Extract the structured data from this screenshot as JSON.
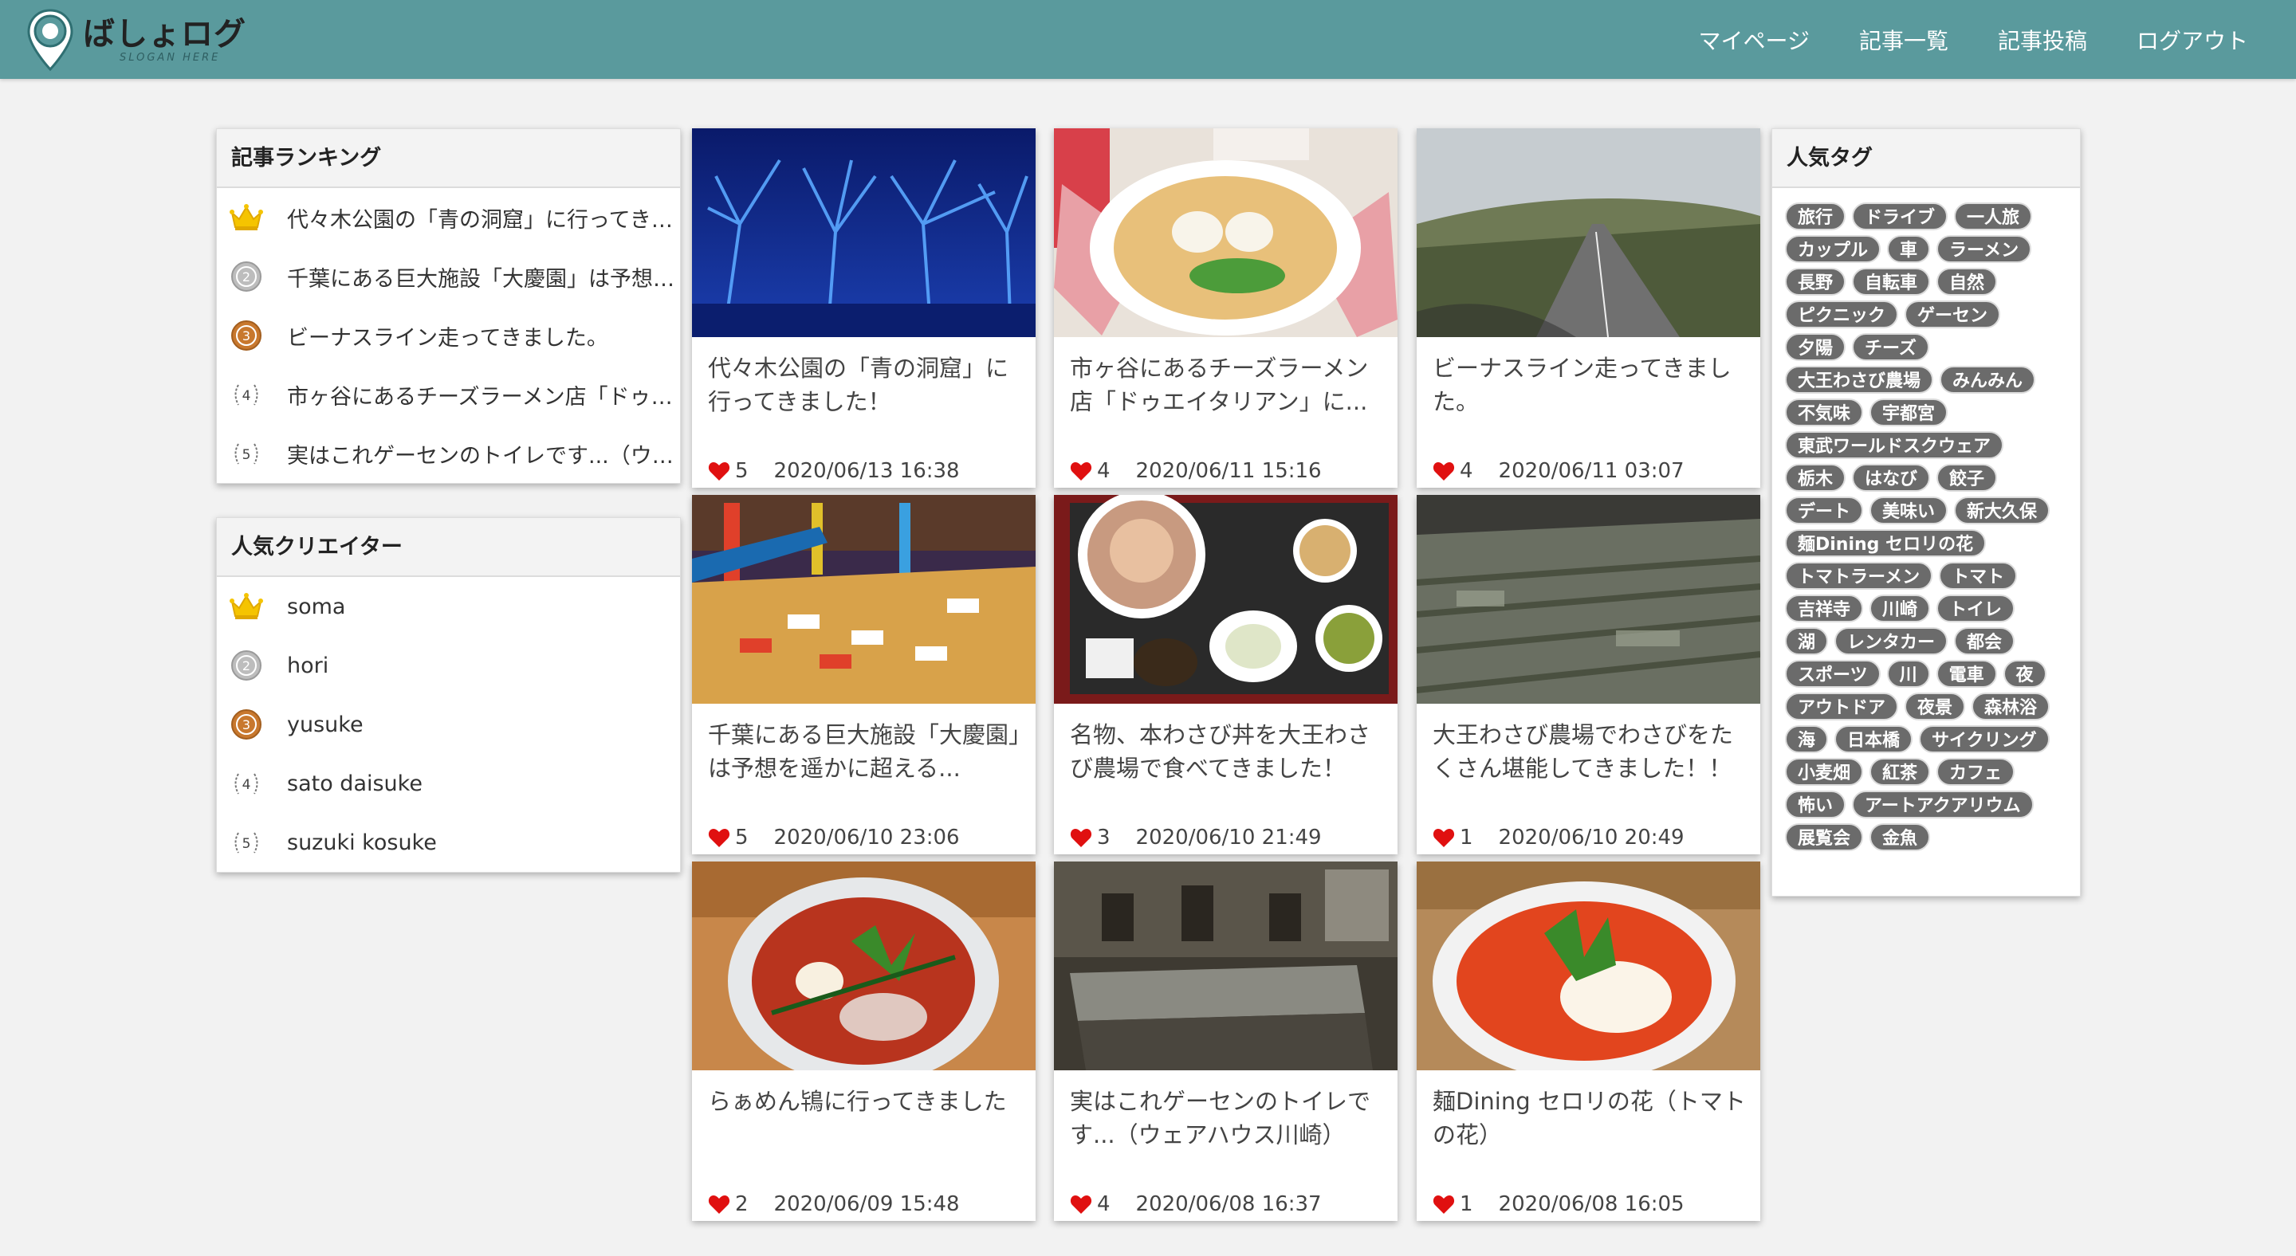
{
  "header": {
    "logo_text": "ばしょログ",
    "logo_sub": "SLOGAN HERE",
    "nav": [
      "マイページ",
      "記事一覧",
      "記事投稿",
      "ログアウト"
    ]
  },
  "ranking": {
    "title": "記事ランキング",
    "items": [
      "代々木公園の「青の洞窟」に行ってきました！",
      "千葉にある巨大施設「大慶園」は予想を遥かに超える...",
      "ビーナスライン走ってきました。",
      "市ヶ谷にあるチーズラーメン店「ドゥエイタリアン」に...",
      "実はこれゲーセンのトイレです...（ウェアハウス川崎）"
    ]
  },
  "creators": {
    "title": "人気クリエイター",
    "items": [
      "soma",
      "hori",
      "yusuke",
      "sato daisuke",
      "suzuki kosuke"
    ]
  },
  "articles": [
    {
      "title": "代々木公園の「青の洞窟」に行ってきました！",
      "likes": "5",
      "date": "2020/06/13 16:38"
    },
    {
      "title": "市ヶ谷にあるチーズラーメン店「ドゥエイタリアン」に...",
      "likes": "4",
      "date": "2020/06/11 15:16"
    },
    {
      "title": "ビーナスライン走ってきました。",
      "likes": "4",
      "date": "2020/06/11 03:07"
    },
    {
      "title": "千葉にある巨大施設「大慶園」は予想を遥かに超える...",
      "likes": "5",
      "date": "2020/06/10 23:06"
    },
    {
      "title": "名物、本わさび丼を大王わさび農場で食べてきました！",
      "likes": "3",
      "date": "2020/06/10 21:49"
    },
    {
      "title": "大王わさび農場でわさびをたくさん堪能してきました！！",
      "likes": "1",
      "date": "2020/06/10 20:49"
    },
    {
      "title": "らぁめん鴇に行ってきました",
      "likes": "2",
      "date": "2020/06/09 15:48"
    },
    {
      "title": "実はこれゲーセンのトイレです...（ウェアハウス川崎）",
      "likes": "4",
      "date": "2020/06/08 16:37"
    },
    {
      "title": "麺Dining セロリの花（トマトの花）",
      "likes": "1",
      "date": "2020/06/08 16:05"
    }
  ],
  "tags": {
    "title": "人気タグ",
    "items": [
      "旅行",
      "ドライブ",
      "一人旅",
      "カップル",
      "車",
      "ラーメン",
      "長野",
      "自転車",
      "自然",
      "ピクニック",
      "ゲーセン",
      "夕陽",
      "チーズ",
      "大王わさび農場",
      "みんみん",
      "不気味",
      "宇都宮",
      "東武ワールドスクウェア",
      "栃木",
      "はなび",
      "餃子",
      "デート",
      "美味い",
      "新大久保",
      "麺Dining セロリの花",
      "トマトラーメン",
      "トマト",
      "吉祥寺",
      "川崎",
      "トイレ",
      "湖",
      "レンタカー",
      "都会",
      "スポーツ",
      "川",
      "電車",
      "夜",
      "アウトドア",
      "夜景",
      "森林浴",
      "海",
      "日本橋",
      "サイクリング",
      "小麦畑",
      "紅茶",
      "カフェ",
      "怖い",
      "アートアクアリウム",
      "展覧会",
      "金魚"
    ]
  },
  "colors": {
    "header": "#5a9a9d",
    "heart": "#e01010",
    "tag": "#6b6b6b"
  }
}
